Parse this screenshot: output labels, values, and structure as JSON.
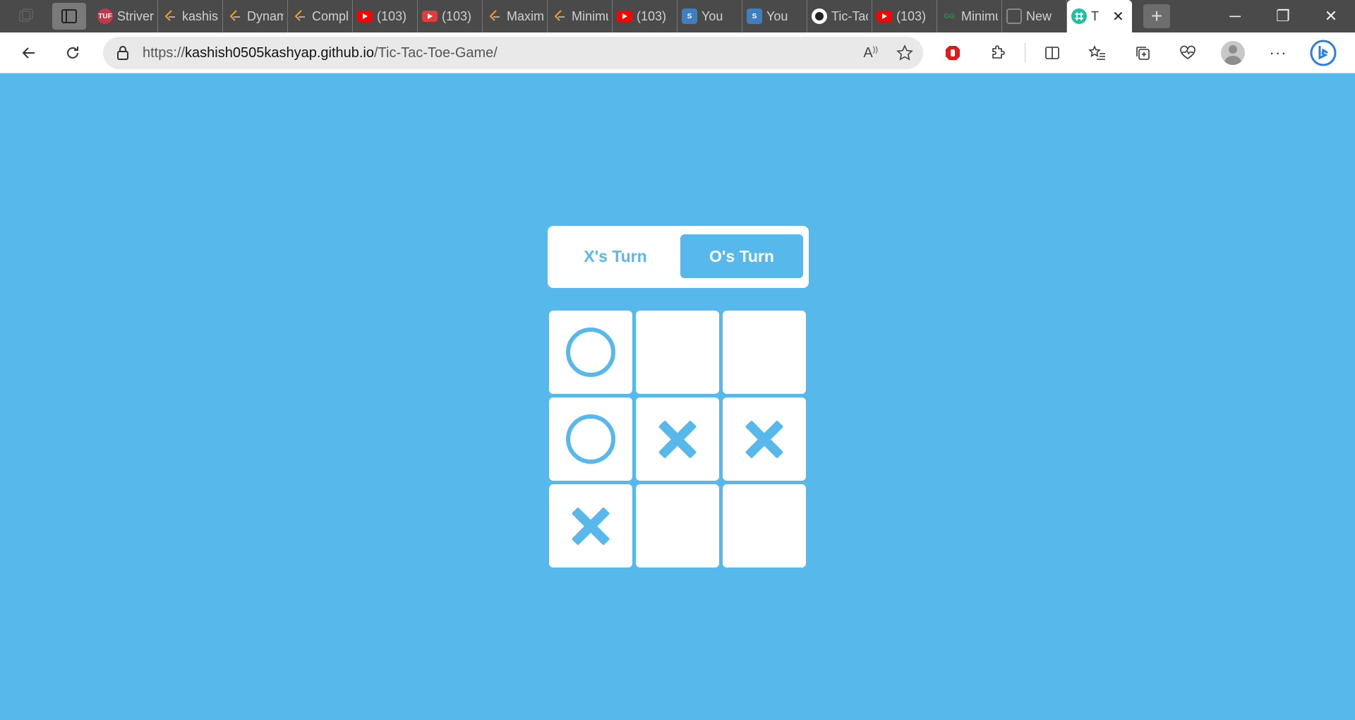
{
  "browser": {
    "tabs": [
      {
        "title": "Striver",
        "icon": "tuf-icon",
        "color": "#c0394b",
        "badge": "TUF"
      },
      {
        "title": "kashish",
        "icon": "leetcode-icon",
        "color": "#f0a030"
      },
      {
        "title": "Dynamic",
        "icon": "leetcode-icon",
        "color": "#f0a030"
      },
      {
        "title": "Complete",
        "icon": "leetcode-icon",
        "color": "#f0a030"
      },
      {
        "title": "(103)",
        "icon": "youtube-icon",
        "color": "#ff0000"
      },
      {
        "title": "(103)",
        "icon": "youtube-icon",
        "color": "#e33a3a"
      },
      {
        "title": "Maximum",
        "icon": "leetcode-icon",
        "color": "#f0a030"
      },
      {
        "title": "Minimum",
        "icon": "leetcode-icon",
        "color": "#f0a030"
      },
      {
        "title": "(103)",
        "icon": "youtube-icon",
        "color": "#ff0000"
      },
      {
        "title": "You",
        "icon": "s-icon",
        "color": "#3f7fbf",
        "badge": "S"
      },
      {
        "title": "You",
        "icon": "s-icon",
        "color": "#3f7fbf",
        "badge": "S"
      },
      {
        "title": "Tic-Tac-Toe",
        "icon": "github-icon",
        "color": "#ffffff"
      },
      {
        "title": "(103)",
        "icon": "youtube-icon",
        "color": "#ff0000"
      },
      {
        "title": "Minimum",
        "icon": "gfg-icon",
        "color": "#2f8d46",
        "badge": "GG"
      },
      {
        "title": "New",
        "icon": "newtab-icon",
        "color": "#888888"
      }
    ],
    "active_tab": {
      "title": "T",
      "icon": "tic-tac-toe-icon",
      "color": "#1bc1a1"
    },
    "url_prefix": "https://",
    "url_host": "kashish0505kashyap.github.io",
    "url_path": "/Tic-Tac-Toe-Game/"
  },
  "game": {
    "x_turn_label": "X's Turn",
    "o_turn_label": "O's Turn",
    "active_turn": "O",
    "board": [
      "O",
      "",
      "",
      "O",
      "X",
      "X",
      "X",
      "",
      ""
    ]
  },
  "colors": {
    "accent": "#56b8eb",
    "surface": "#ffffff"
  }
}
